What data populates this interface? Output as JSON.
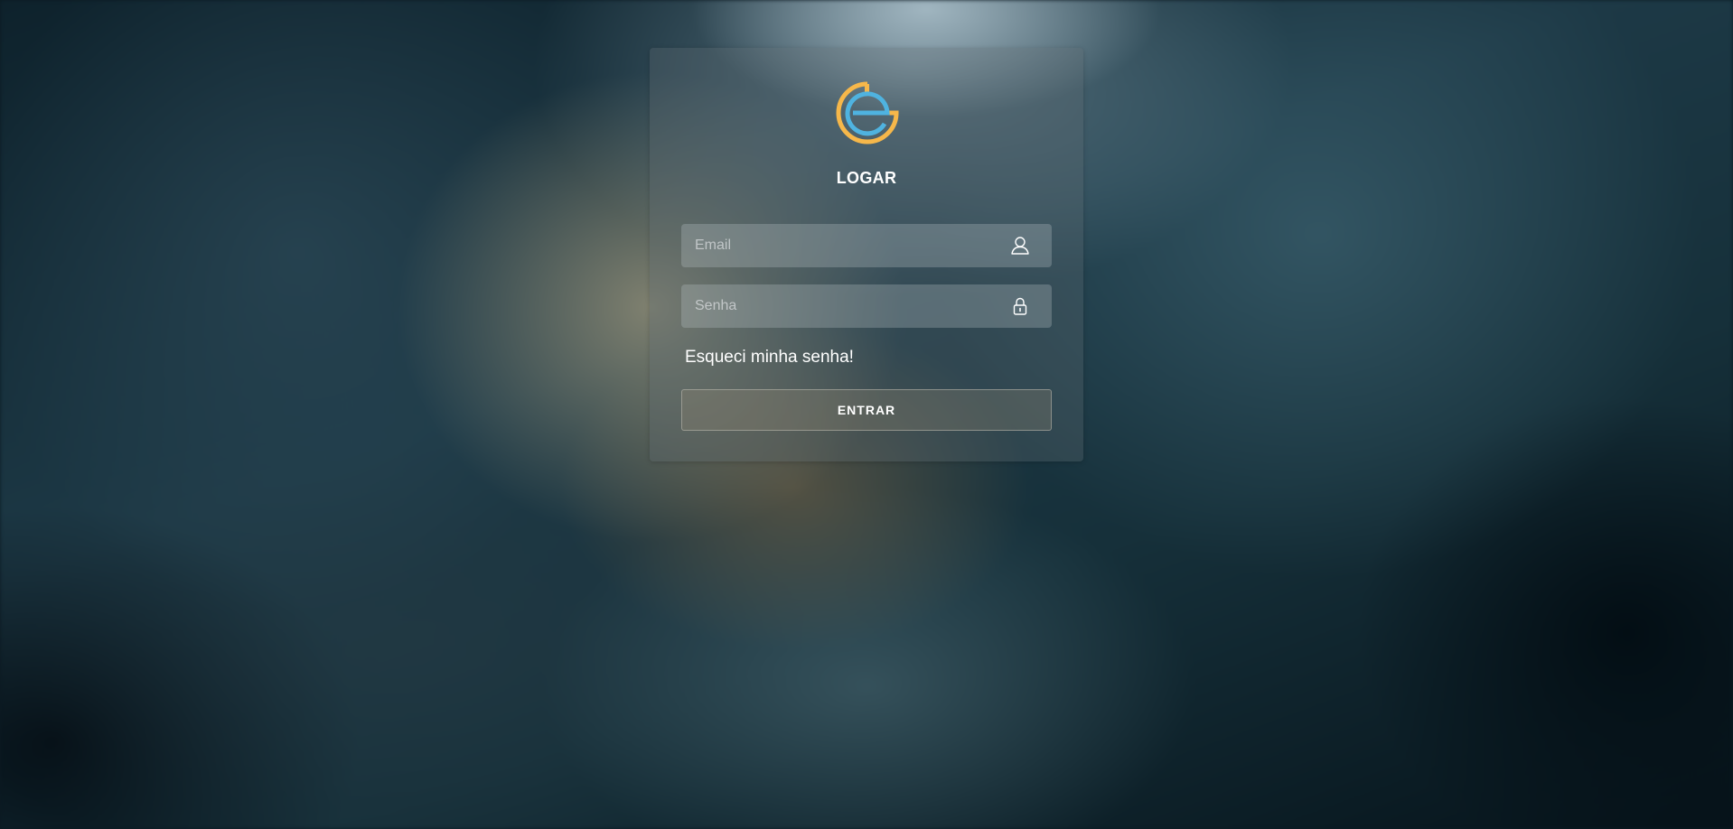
{
  "login": {
    "title": "LOGAR",
    "email_placeholder": "Email",
    "password_placeholder": "Senha",
    "forgot_link": "Esqueci minha senha!",
    "submit_label": "ENTRAR",
    "icons": {
      "logo": "eg-logo",
      "email": "user-icon",
      "password": "lock-icon"
    },
    "colors": {
      "logo_orange": "#f6b74a",
      "logo_blue": "#4fb3e0",
      "text": "#ffffff"
    }
  }
}
